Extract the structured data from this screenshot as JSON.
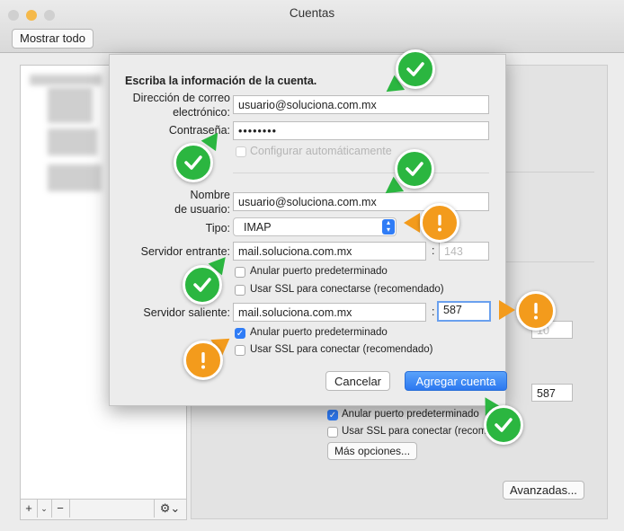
{
  "window": {
    "title": "Cuentas",
    "show_all": "Mostrar todo"
  },
  "sheet": {
    "heading": "Escriba la información de la cuenta.",
    "email": {
      "label_line1": "Dirección de correo",
      "label_line2": "electrónico:",
      "value": "usuario@soluciona.com.mx"
    },
    "password": {
      "label": "Contraseña:",
      "value": "••••••••"
    },
    "auto_config": {
      "label": "Configurar automáticamente",
      "checked": false
    },
    "username": {
      "label_line1": "Nombre",
      "label_line2": "de usuario:",
      "value": "usuario@soluciona.com.mx"
    },
    "type": {
      "label": "Tipo:",
      "value": "IMAP"
    },
    "incoming": {
      "label": "Servidor entrante:",
      "value": "mail.soluciona.com.mx",
      "colon": ":",
      "port_placeholder": "143",
      "override_port": {
        "label": "Anular puerto predeterminado",
        "checked": false
      },
      "use_ssl": {
        "label": "Usar SSL para conectarse (recomendado)",
        "checked": false
      }
    },
    "outgoing": {
      "label": "Servidor saliente:",
      "value": "mail.soluciona.com.mx",
      "colon": ":",
      "port": "587",
      "override_port": {
        "label": "Anular puerto predeterminado",
        "checked": true
      },
      "use_ssl": {
        "label": "Usar SSL para conectar (recomendado)",
        "checked": false
      }
    },
    "cancel": "Cancelar",
    "add_account": "Agregar cuenta"
  },
  "background": {
    "port_value": "587",
    "override_port": {
      "label": "Anular puerto predeterminado",
      "checked": true
    },
    "use_ssl": {
      "label": "Usar SSL para conectar (recom",
      "checked": false
    },
    "more_options": "Más opciones...",
    "advanced": "Avanzadas...",
    "add_button": "+",
    "remove_button": "−",
    "partial_field": "10"
  },
  "badges": {
    "ok_glyph": "check-icon",
    "warn_glyph": "exclamation-icon",
    "ok_color": "#2bb640",
    "warn_color": "#f39b1c"
  },
  "colors": {
    "accent": "#2f7cf6",
    "ok": "#2bb640",
    "warn": "#f39b1c"
  }
}
